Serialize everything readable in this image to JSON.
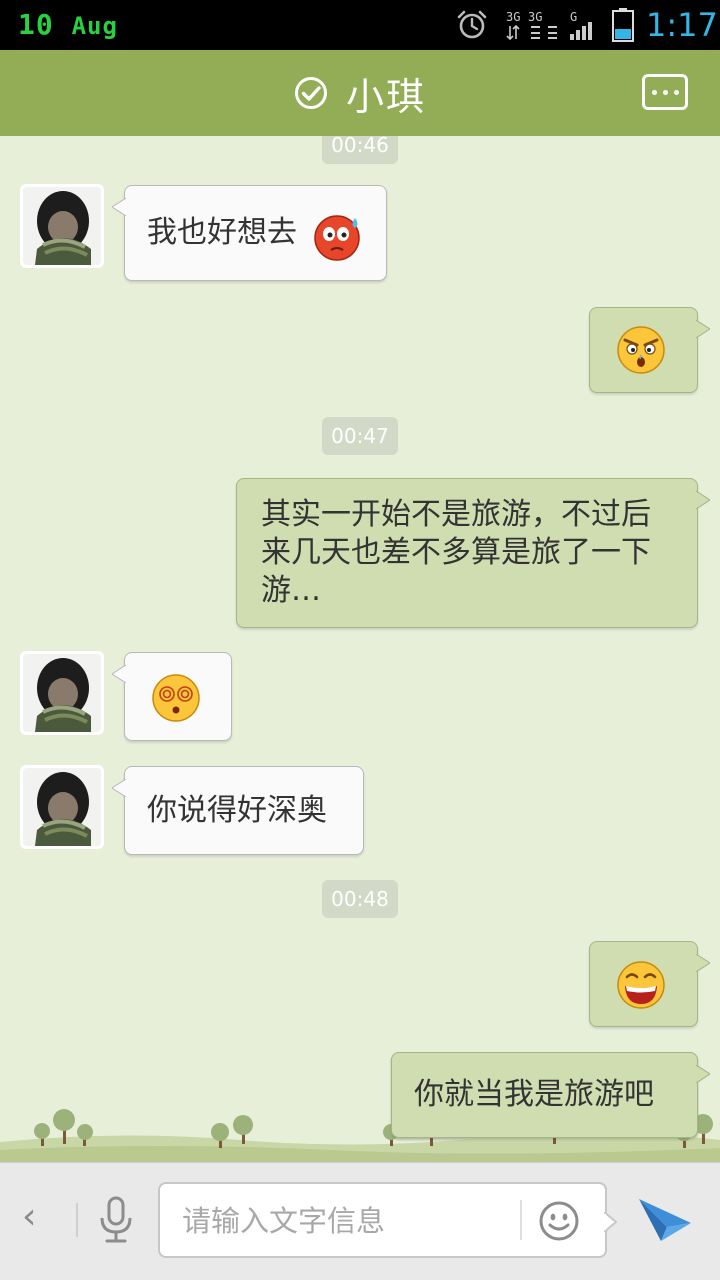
{
  "status_bar": {
    "day": "10",
    "month": "Aug",
    "network": "3G",
    "network2": "3G",
    "network3": "G",
    "time": "1:17",
    "icons": [
      "alarm-icon",
      "signal-icon",
      "battery-icon"
    ]
  },
  "header": {
    "title": "小琪",
    "status_icon": "check-circle-icon",
    "menu_icon": "more-icon"
  },
  "messages": [
    {
      "kind": "timestamp",
      "text": "00:46"
    },
    {
      "kind": "in",
      "text": "我也好想去",
      "emoji": "blush-sweat-emoji"
    },
    {
      "kind": "out",
      "emoji": "angry-emoji"
    },
    {
      "kind": "timestamp",
      "text": "00:47"
    },
    {
      "kind": "out",
      "text": "其实一开始不是旅游，不过后来几天也差不多算是旅了一下游…"
    },
    {
      "kind": "in",
      "emoji": "dizzy-emoji"
    },
    {
      "kind": "in",
      "text": "你说得好深奥"
    },
    {
      "kind": "timestamp",
      "text": "00:48"
    },
    {
      "kind": "out",
      "emoji": "grin-emoji"
    },
    {
      "kind": "out",
      "text": "你就当我是旅游吧"
    }
  ],
  "input_bar": {
    "back_label": "‹",
    "placeholder": "请输入文字信息",
    "value": "",
    "icons": [
      "back-icon",
      "microphone-icon",
      "smiley-icon",
      "send-icon"
    ]
  },
  "colors": {
    "header": "#92ad55",
    "background": "#e8efd9",
    "bubble_out": "#cfddb0",
    "bubble_in": "#fafafa",
    "time_accent": "#33b5e5",
    "date_accent": "#27d13f"
  }
}
